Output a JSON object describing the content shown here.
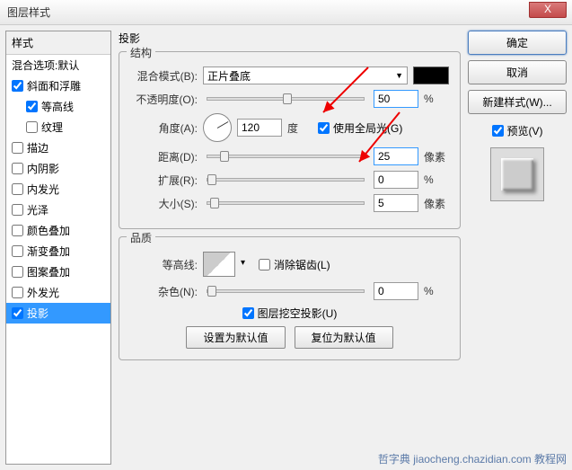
{
  "title": "图层样式",
  "close": "X",
  "styles": {
    "header": "样式",
    "blend_options": "混合选项:默认",
    "items": [
      {
        "label": "斜面和浮雕",
        "checked": true,
        "indent": false
      },
      {
        "label": "等高线",
        "checked": true,
        "indent": true
      },
      {
        "label": "纹理",
        "checked": false,
        "indent": true
      },
      {
        "label": "描边",
        "checked": false,
        "indent": false
      },
      {
        "label": "内阴影",
        "checked": false,
        "indent": false
      },
      {
        "label": "内发光",
        "checked": false,
        "indent": false
      },
      {
        "label": "光泽",
        "checked": false,
        "indent": false
      },
      {
        "label": "颜色叠加",
        "checked": false,
        "indent": false
      },
      {
        "label": "渐变叠加",
        "checked": false,
        "indent": false
      },
      {
        "label": "图案叠加",
        "checked": false,
        "indent": false
      },
      {
        "label": "外发光",
        "checked": false,
        "indent": false
      },
      {
        "label": "投影",
        "checked": true,
        "indent": false,
        "selected": true
      }
    ]
  },
  "drop_shadow": {
    "panel_title": "投影",
    "structure_title": "结构",
    "blend_mode_label": "混合模式(B):",
    "blend_mode_value": "正片叠底",
    "opacity_label": "不透明度(O):",
    "opacity_value": "50",
    "opacity_unit": "%",
    "angle_label": "角度(A):",
    "angle_value": "120",
    "angle_unit": "度",
    "global_light_label": "使用全局光(G)",
    "global_light_checked": true,
    "distance_label": "距离(D):",
    "distance_value": "25",
    "distance_unit": "像素",
    "spread_label": "扩展(R):",
    "spread_value": "0",
    "spread_unit": "%",
    "size_label": "大小(S):",
    "size_value": "5",
    "size_unit": "像素",
    "quality_title": "品质",
    "contour_label": "等高线:",
    "antialias_label": "消除锯齿(L)",
    "antialias_checked": false,
    "noise_label": "杂色(N):",
    "noise_value": "0",
    "noise_unit": "%",
    "knockout_label": "图层挖空投影(U)",
    "knockout_checked": true,
    "make_default": "设置为默认值",
    "reset_default": "复位为默认值"
  },
  "buttons": {
    "ok": "确定",
    "cancel": "取消",
    "new_style": "新建样式(W)...",
    "preview": "预览(V)"
  },
  "watermark": "哲字典 jiaocheng.chazidian.com 教程网"
}
